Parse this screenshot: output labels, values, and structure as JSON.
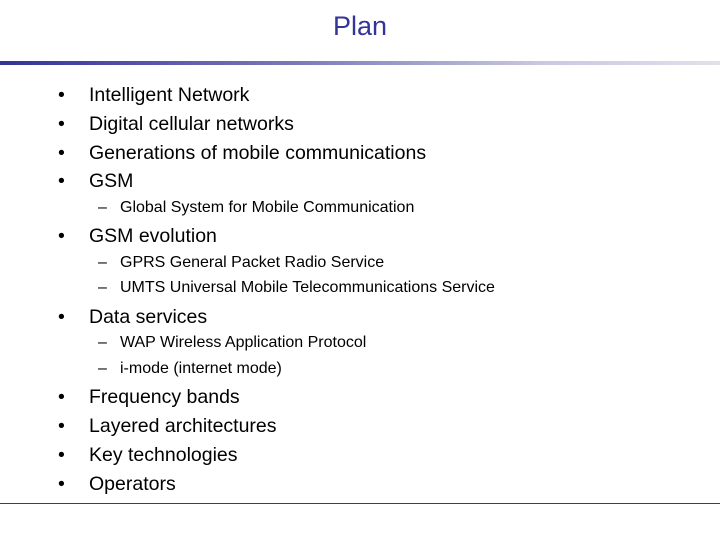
{
  "slide": {
    "title": "Plan",
    "accent_color": "#333399",
    "bullet_glyph": "•",
    "sub_bullet_glyph": "–",
    "items": [
      {
        "level": 1,
        "text": "Intelligent Network"
      },
      {
        "level": 1,
        "text": "Digital cellular networks"
      },
      {
        "level": 1,
        "text": "Generations of mobile communications"
      },
      {
        "level": 1,
        "text": "GSM"
      },
      {
        "level": 2,
        "text": "Global System for Mobile Communication"
      },
      {
        "level": 1,
        "text": "GSM evolution"
      },
      {
        "level": 2,
        "text": "GPRS General Packet Radio Service"
      },
      {
        "level": 2,
        "text": "UMTS Universal Mobile Telecommunications Service"
      },
      {
        "level": 1,
        "text": "Data services"
      },
      {
        "level": 2,
        "text": "WAP Wireless Application Protocol"
      },
      {
        "level": 2,
        "text": "i-mode (internet mode)"
      },
      {
        "level": 1,
        "text": "Frequency bands"
      },
      {
        "level": 1,
        "text": "Layered architectures"
      },
      {
        "level": 1,
        "text": "Key technologies"
      },
      {
        "level": 1,
        "text": "Operators"
      }
    ]
  }
}
